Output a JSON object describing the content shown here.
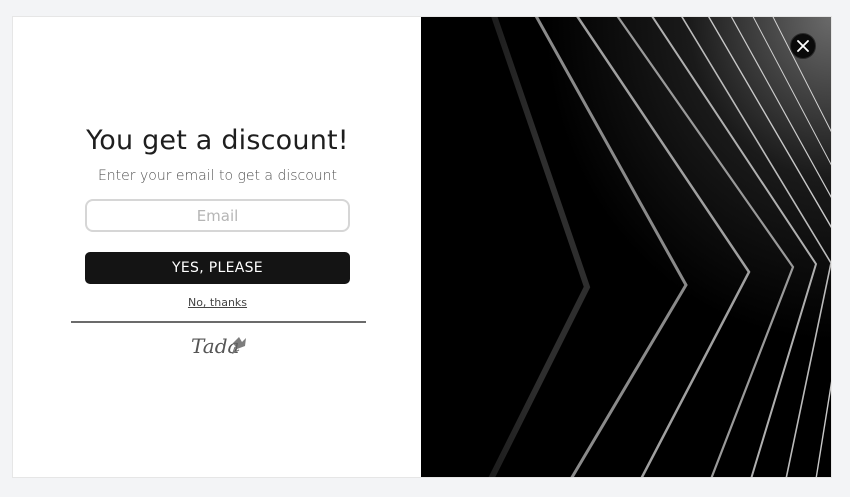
{
  "popup": {
    "headline": "You get a discount!",
    "subheadline": "Enter your email to get a discount",
    "email_placeholder": "Email",
    "submit_label": "YES, PLEASE",
    "decline_label": "No, thanks",
    "brand": "Tada"
  },
  "icons": {
    "close": "close-icon",
    "brand_logo": "tada-logo"
  },
  "colors": {
    "button_bg": "#141414",
    "button_text": "#ffffff",
    "page_bg": "#f3f4f6"
  }
}
